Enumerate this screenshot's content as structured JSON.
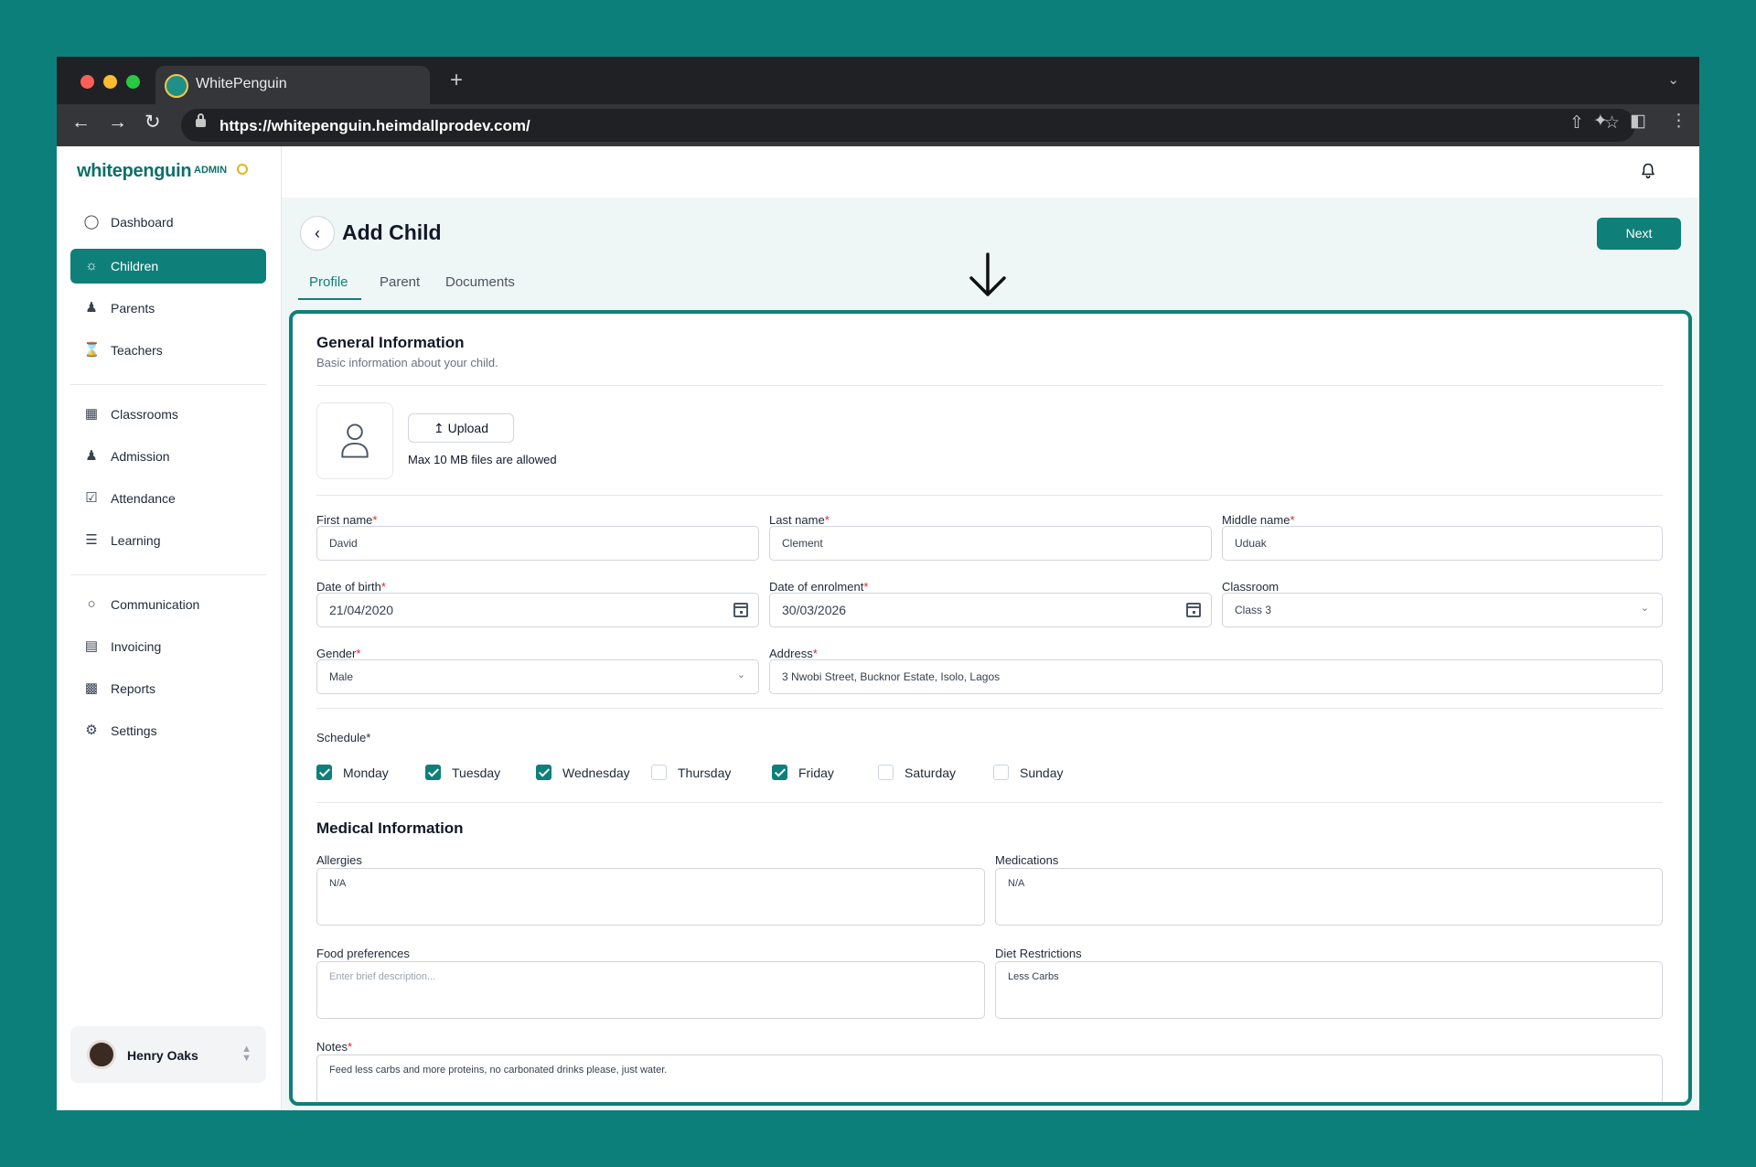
{
  "browser": {
    "tab_title": "WhitePenguin",
    "new_tab": "+",
    "url": "https://whitepenguin.heimdallprodev.com/"
  },
  "brand": {
    "logo": "whitepenguin",
    "badge": "ADMIN"
  },
  "sidebar": {
    "items": [
      {
        "label": "Dashboard",
        "icon": "dashboard-icon"
      },
      {
        "label": "Children",
        "icon": "children-icon",
        "active": true
      },
      {
        "label": "Parents",
        "icon": "parents-icon"
      },
      {
        "label": "Teachers",
        "icon": "teachers-icon"
      },
      {
        "label": "Classrooms",
        "icon": "classrooms-icon"
      },
      {
        "label": "Admission",
        "icon": "admission-icon"
      },
      {
        "label": "Attendance",
        "icon": "attendance-icon"
      },
      {
        "label": "Learning",
        "icon": "learning-icon"
      },
      {
        "label": "Communication",
        "icon": "communication-icon"
      },
      {
        "label": "Invoicing",
        "icon": "invoicing-icon"
      },
      {
        "label": "Reports",
        "icon": "reports-icon"
      },
      {
        "label": "Settings",
        "icon": "settings-icon"
      }
    ],
    "user": {
      "name": "Henry Oaks"
    }
  },
  "page": {
    "title": "Add Child",
    "next_label": "Next",
    "tabs": [
      "Profile",
      "Parent",
      "Documents"
    ],
    "active_tab": "Profile"
  },
  "general": {
    "title": "General Information",
    "subtitle": "Basic information about your child.",
    "upload_label": "Upload",
    "upload_hint": "Max 10 MB files are allowed",
    "first_name": {
      "label": "First name",
      "value": "David"
    },
    "last_name": {
      "label": "Last name",
      "value": "Clement"
    },
    "middle_name": {
      "label": "Middle name",
      "value": "Uduak"
    },
    "dob": {
      "label": "Date of birth",
      "value": "21/04/2020"
    },
    "enrolment": {
      "label": "Date of enrolment",
      "value": "30/03/2026"
    },
    "classroom": {
      "label": "Classroom",
      "value": "Class 3"
    },
    "gender": {
      "label": "Gender",
      "value": "Male"
    },
    "address": {
      "label": "Address",
      "value": "3 Nwobi Street, Bucknor Estate, Isolo, Lagos"
    },
    "required_mark": "*"
  },
  "schedule": {
    "label": "Schedule*",
    "days": [
      {
        "label": "Monday",
        "checked": true
      },
      {
        "label": "Tuesday",
        "checked": true
      },
      {
        "label": "Wednesday",
        "checked": true
      },
      {
        "label": "Thursday",
        "checked": false
      },
      {
        "label": "Friday",
        "checked": true
      },
      {
        "label": "Saturday",
        "checked": false
      },
      {
        "label": "Sunday",
        "checked": false
      }
    ]
  },
  "medical": {
    "title": "Medical Information",
    "allergies": {
      "label": "Allergies",
      "value": "N/A"
    },
    "medications": {
      "label": "Medications",
      "value": "N/A"
    },
    "food": {
      "label": "Food preferences",
      "placeholder": "Enter brief description..."
    },
    "diet": {
      "label": "Diet Restrictions",
      "value": "Less Carbs"
    },
    "notes": {
      "label": "Notes",
      "value": "Feed less carbs and more proteins, no carbonated drinks please, just water."
    }
  },
  "colors": {
    "brand": "#0f7f79",
    "background": "#0d7f7a",
    "required": "#dc2626"
  }
}
